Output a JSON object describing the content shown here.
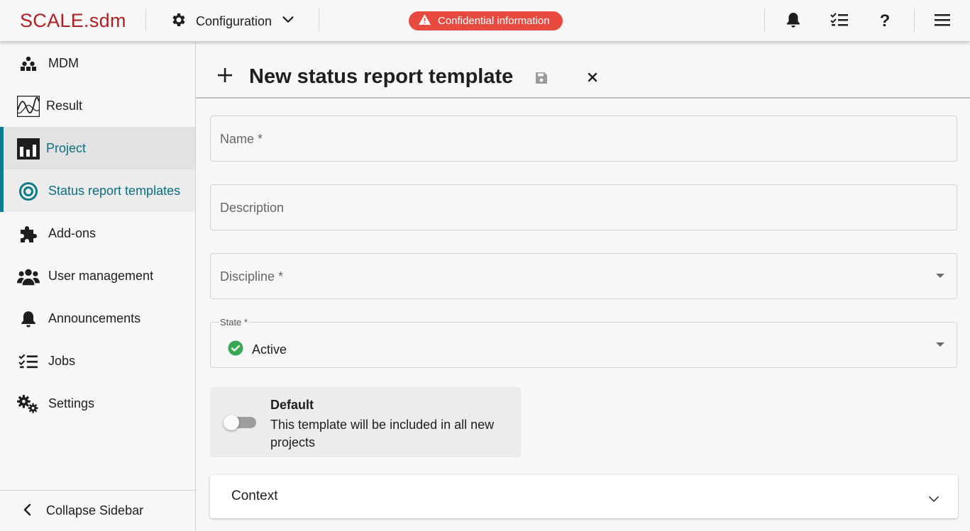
{
  "app": {
    "logo": "SCALE.sdm"
  },
  "topbar": {
    "config_label": "Configuration",
    "confidential_label": "Confidential information",
    "icons": [
      "gear-icon",
      "chevron-down-icon",
      "warning-icon",
      "bell-icon",
      "checklist-icon",
      "help-icon",
      "menu-icon"
    ],
    "help_glyph": "?"
  },
  "sidebar": {
    "items": [
      {
        "label": "MDM",
        "icon": "mdm-icon"
      },
      {
        "label": "Result",
        "icon": "result-chart-icon"
      },
      {
        "label": "Project",
        "icon": "project-icon"
      },
      {
        "label": "Status report templates",
        "icon": "target-icon"
      },
      {
        "label": "Add-ons",
        "icon": "puzzle-icon"
      },
      {
        "label": "User management",
        "icon": "users-icon"
      },
      {
        "label": "Announcements",
        "icon": "bell-icon"
      },
      {
        "label": "Jobs",
        "icon": "checklist-icon"
      },
      {
        "label": "Settings",
        "icon": "gears-icon"
      }
    ],
    "collapse_label": "Collapse Sidebar"
  },
  "main": {
    "title": "New status report template",
    "fields": {
      "name_placeholder": "Name *",
      "description_placeholder": "Description",
      "discipline_placeholder": "Discipline *",
      "state_label": "State *",
      "state_value": "Active"
    },
    "default_toggle": {
      "title": "Default",
      "description": "This template will be included in all new projects",
      "checked": false
    },
    "context_label": "Context"
  },
  "colors": {
    "brand": "#b01f24",
    "accent": "#0b7b8c",
    "badge": "#e94a3f",
    "success": "#3aa753"
  }
}
